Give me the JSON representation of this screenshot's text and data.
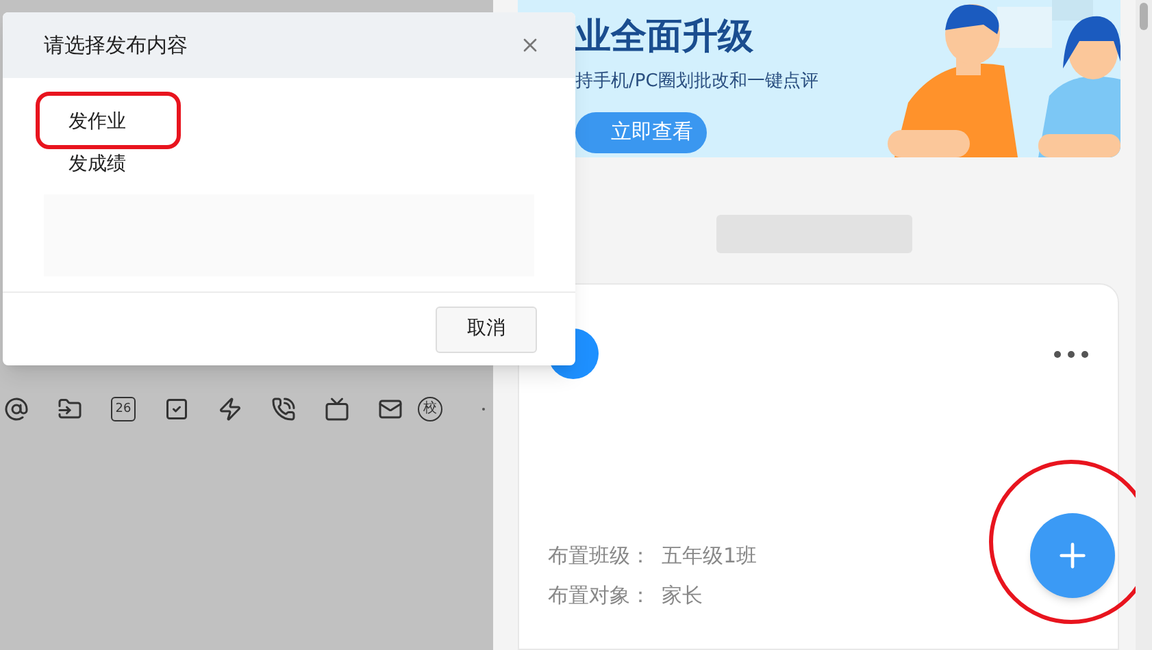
{
  "dialog": {
    "title": "请选择发布内容",
    "options": [
      {
        "label": "发作业",
        "annotated": true
      },
      {
        "label": "发成绩",
        "annotated": false
      }
    ],
    "cancel": "取消"
  },
  "toolbar": {
    "calendar_day": "26",
    "school_badge": "校"
  },
  "banner": {
    "title": "业全面升级",
    "subtitle": "持手机/PC圈划批改和一键点评",
    "button": "立即查看"
  },
  "card": {
    "fields": [
      {
        "label": "布置班级：",
        "value": "五年级1班"
      },
      {
        "label": "布置对象：",
        "value": "家长"
      }
    ]
  },
  "fab": {
    "annotated": true
  }
}
